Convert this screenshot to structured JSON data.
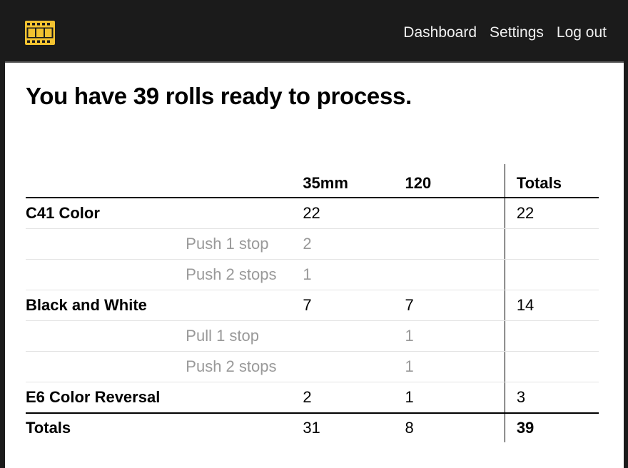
{
  "brand": {
    "icon": "film-strip-icon",
    "color": "#f2c230"
  },
  "nav": {
    "dashboard": "Dashboard",
    "settings": "Settings",
    "logout": "Log out"
  },
  "headline": "You have 39 rolls ready to process.",
  "table": {
    "headers": {
      "format_35mm": "35mm",
      "format_120": "120",
      "totals": "Totals"
    },
    "rows": [
      {
        "process": "C41 Color",
        "modifier": "",
        "v35": "22",
        "v120": "",
        "total": "22"
      },
      {
        "process": "",
        "modifier": "Push 1 stop",
        "v35": "2",
        "v120": "",
        "total": ""
      },
      {
        "process": "",
        "modifier": "Push 2 stops",
        "v35": "1",
        "v120": "",
        "total": ""
      },
      {
        "process": "Black and White",
        "modifier": "",
        "v35": "7",
        "v120": "7",
        "total": "14"
      },
      {
        "process": "",
        "modifier": "Pull 1 stop",
        "v35": "",
        "v120": "1",
        "total": ""
      },
      {
        "process": "",
        "modifier": "Push 2 stops",
        "v35": "",
        "v120": "1",
        "total": ""
      },
      {
        "process": "E6 Color Reversal",
        "modifier": "",
        "v35": "2",
        "v120": "1",
        "total": "3"
      }
    ],
    "footer": {
      "label": "Totals",
      "v35": "31",
      "v120": "8",
      "total": "39"
    }
  }
}
